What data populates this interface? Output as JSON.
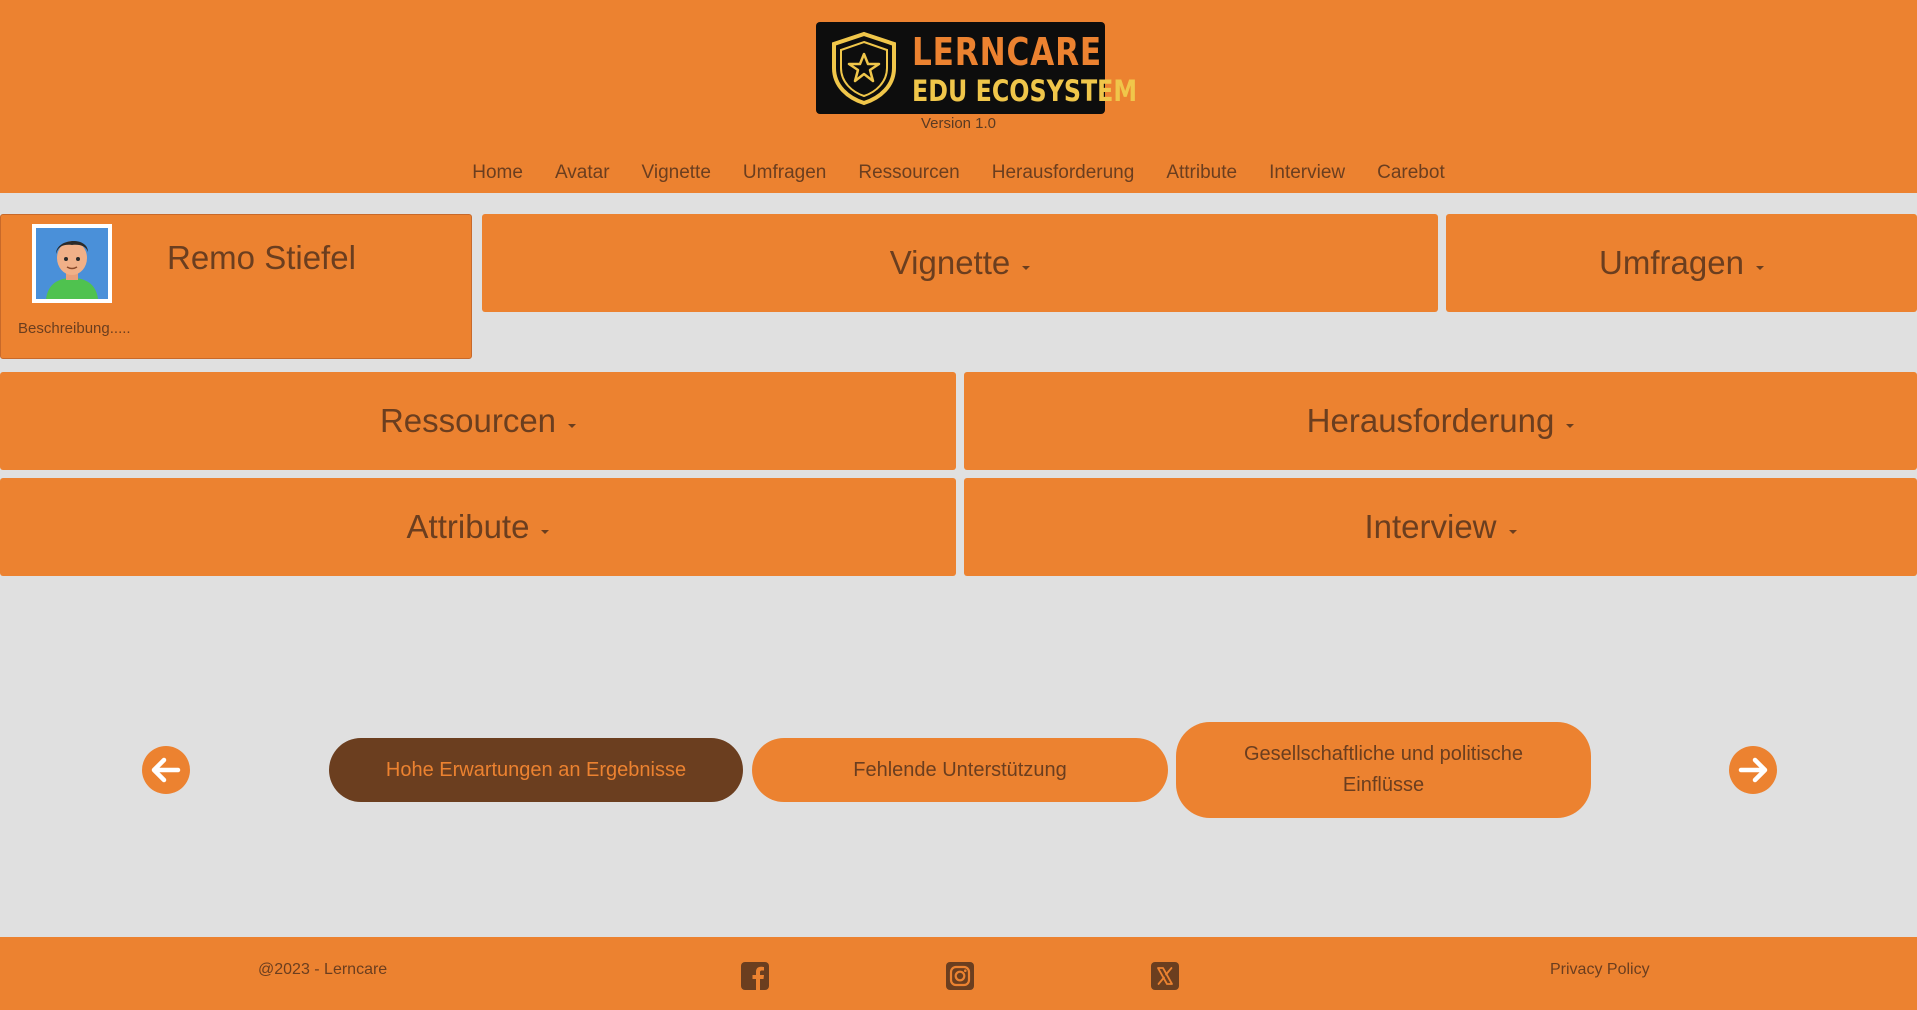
{
  "logo": {
    "line1": "LERNCARE",
    "line2": "EDU ECOSYSTEM"
  },
  "version": "Version 1.0",
  "nav": [
    "Home",
    "Avatar",
    "Vignette",
    "Umfragen",
    "Ressourcen",
    "Herausforderung",
    "Attribute",
    "Interview",
    "Carebot"
  ],
  "profile": {
    "name": "Remo Stiefel",
    "description": "Beschreibung....."
  },
  "tiles": {
    "vignette": "Vignette",
    "umfragen": "Umfragen",
    "ressourcen": "Ressourcen",
    "herausforderung": "Herausforderung",
    "attribute": "Attribute",
    "interview": "Interview"
  },
  "carousel": {
    "items": [
      {
        "label": "Hohe Erwartungen an Ergebnisse",
        "active": true
      },
      {
        "label": "Fehlende Unterstützung",
        "active": false
      },
      {
        "label": "Gesellschaftliche und politische Einflüsse",
        "active": false
      }
    ],
    "prev_icon": "arrow-left-icon",
    "next_icon": "arrow-right-icon"
  },
  "footer": {
    "copyright": "@2023 - Lerncare",
    "privacy": "Privacy Policy",
    "social": [
      "facebook-icon",
      "instagram-icon",
      "x-icon"
    ]
  },
  "colors": {
    "accent": "#ec8230",
    "dark": "#6b3e1f",
    "background": "#e0e0e0",
    "logo_bg": "#0d0d0d",
    "logo_yellow": "#f0c64a"
  }
}
